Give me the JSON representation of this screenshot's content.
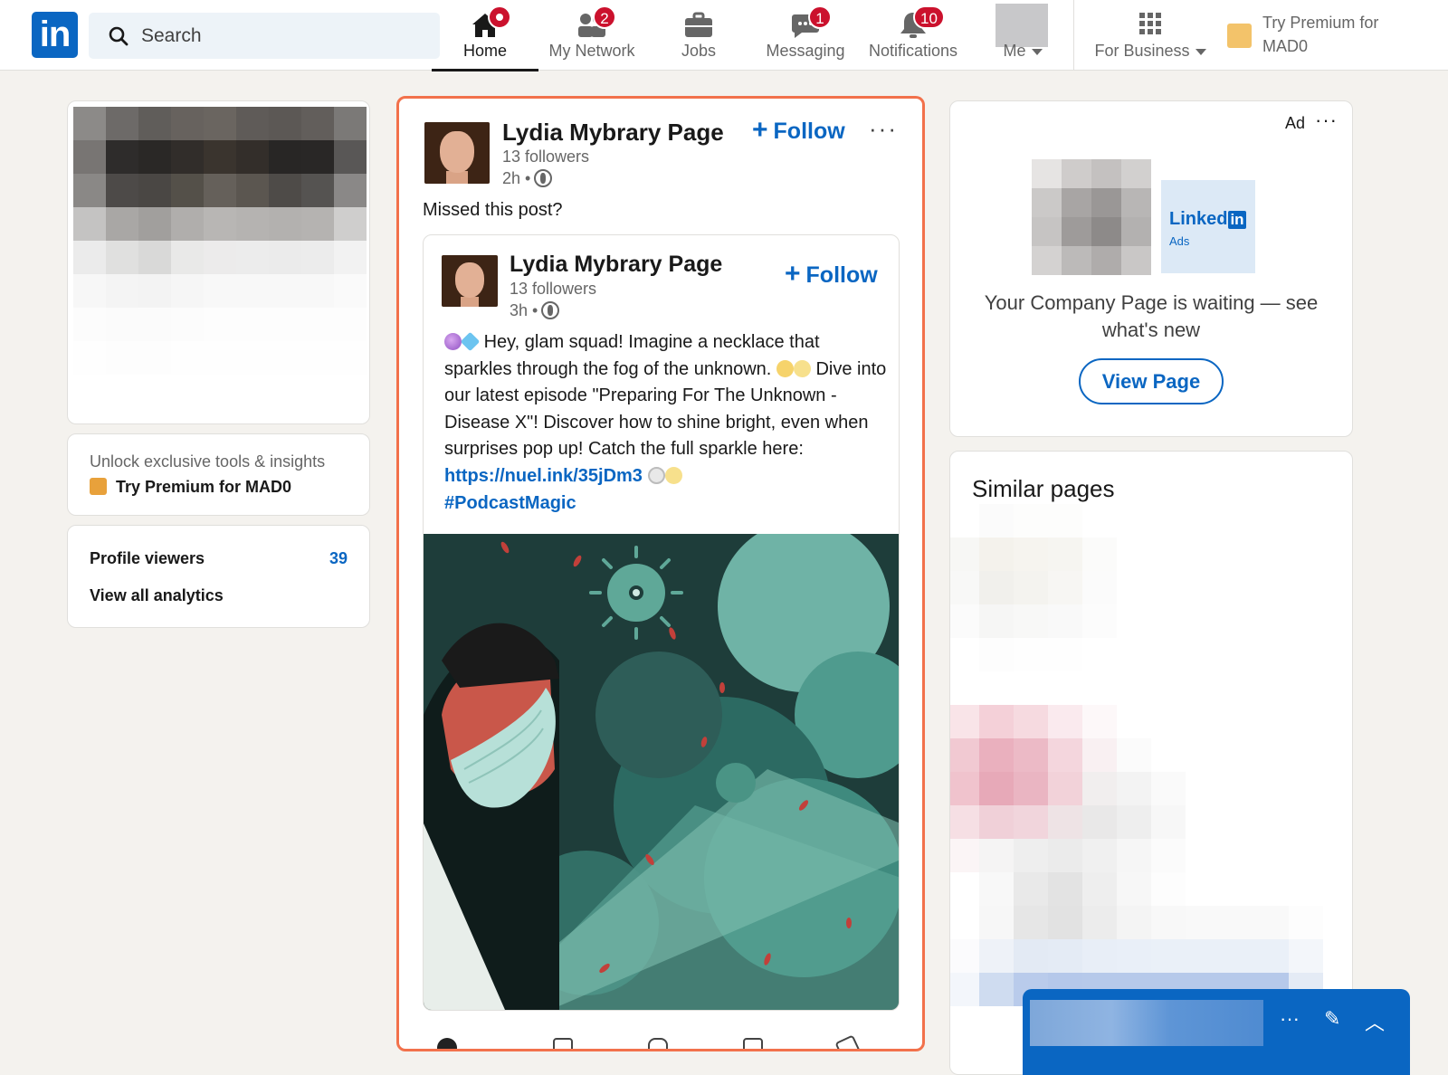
{
  "nav": {
    "logo": "in",
    "search_placeholder": "Search",
    "items": [
      {
        "label": "Home"
      },
      {
        "label": "My Network",
        "badge": "2"
      },
      {
        "label": "Jobs"
      },
      {
        "label": "Messaging",
        "badge": "1"
      },
      {
        "label": "Notifications",
        "badge": "10"
      },
      {
        "label": "Me"
      },
      {
        "label": "For Business"
      }
    ],
    "premium": "Try Premium for MAD0"
  },
  "left": {
    "premium_sub": "Unlock exclusive tools & insights",
    "premium_cta": "Try Premium for MAD0",
    "profile_viewers_label": "Profile viewers",
    "profile_viewers_count": "39",
    "view_analytics": "View all analytics"
  },
  "feed": {
    "outer": {
      "name": "Lydia Mybrary Page",
      "followers": "13 followers",
      "time": "2h •",
      "follow": "Follow",
      "more": "···",
      "intro": "Missed this post?"
    },
    "inner": {
      "name": "Lydia Mybrary Page",
      "followers": "13 followers",
      "time": "3h •",
      "follow": "Follow",
      "body_1": "Hey, glam squad! Imagine a necklace that sparkles through the fog of the unknown.",
      "body_2": "Dive into our latest episode \"Preparing For The Unknown - Disease X\"! Discover how to shine bright, even when surprises pop up! Catch the full sparkle here:",
      "link": "https://nuel.ink/35jDm3",
      "hashtag": "#PodcastMagic"
    }
  },
  "ad": {
    "label": "Ad",
    "more": "···",
    "logo_word": "Linked",
    "logo_in": "in",
    "logo_sub": "Ads",
    "text": "Your Company Page is waiting — see what's new",
    "button": "View Page"
  },
  "similar": {
    "title": "Similar pages"
  },
  "messaging": {
    "more": "···",
    "compose": "✎",
    "collapse": "︿"
  },
  "colors": {
    "brand": "#0a66c2",
    "badge": "#cb112d",
    "highlight": "#f2714b"
  }
}
